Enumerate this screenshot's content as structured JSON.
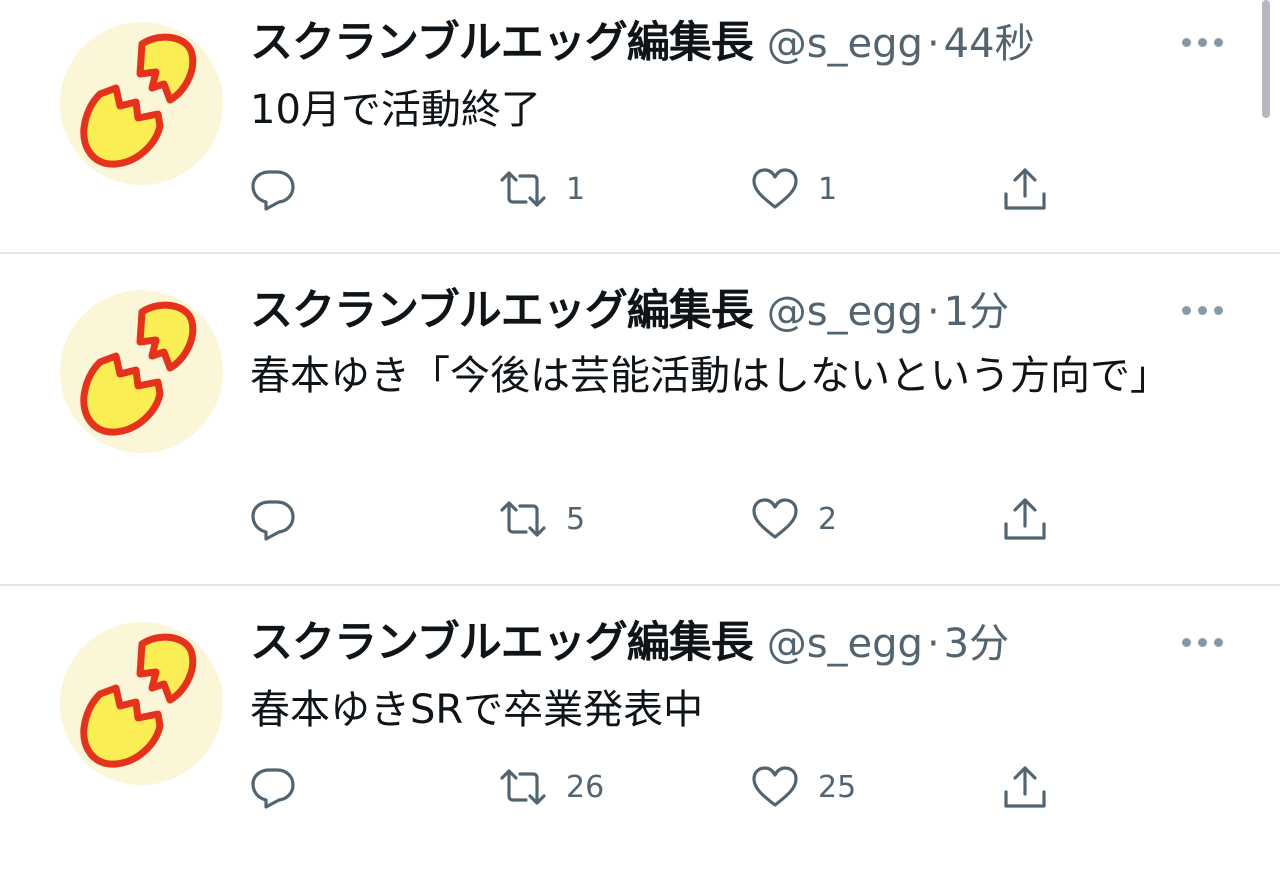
{
  "tweets": [
    {
      "author": "スクランブルエッグ編集長",
      "handle": "@s_egg",
      "separator": "·",
      "time": "44秒",
      "text": "10月で活動終了",
      "replies": "",
      "retweets": "1",
      "likes": "1"
    },
    {
      "author": "スクランブルエッグ編集長",
      "handle": "@s_egg",
      "separator": "·",
      "time": "1分",
      "text": "春本ゆき「今後は芸能活動はしないという方向で」",
      "replies": "",
      "retweets": "5",
      "likes": "2"
    },
    {
      "author": "スクランブルエッグ編集長",
      "handle": "@s_egg",
      "separator": "·",
      "time": "3分",
      "text": "春本ゆきSRで卒業発表中",
      "replies": "",
      "retweets": "26",
      "likes": "25"
    }
  ],
  "icons": {
    "more": "more-horizontal-icon",
    "reply": "reply-icon",
    "retweet": "retweet-icon",
    "like": "heart-icon",
    "share": "share-icon"
  },
  "colors": {
    "text": "#0f1419",
    "secondary": "#536471",
    "divider": "#e1e6ea",
    "avatar_bg": "#fbf6d8",
    "egg_fill": "#fbee55",
    "egg_stroke": "#e5321d"
  }
}
